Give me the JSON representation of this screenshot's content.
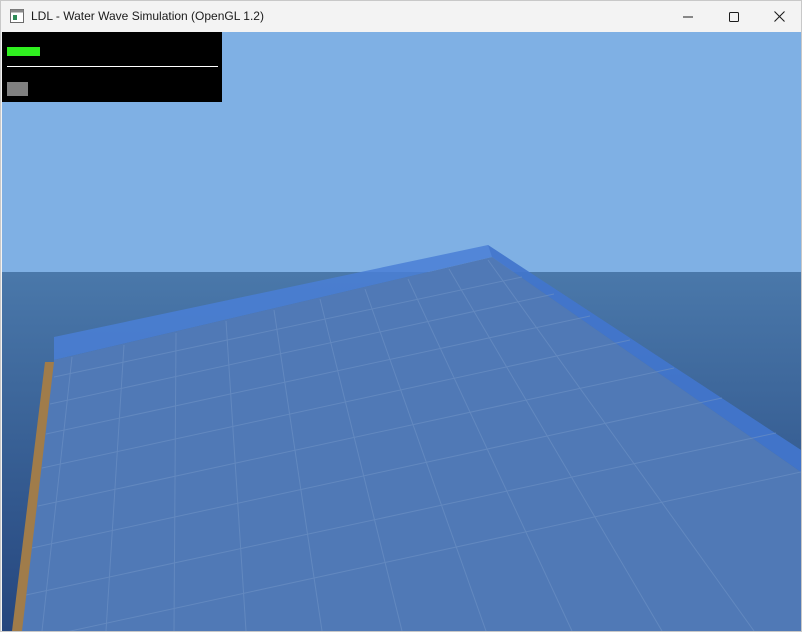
{
  "window": {
    "title": "LDL - Water Wave Simulation (OpenGL 1.2)",
    "app_icon": "window-app-icon",
    "controls": [
      "minimize-icon",
      "maximize-icon",
      "close-icon"
    ]
  },
  "scene": {
    "sky_color": "#7fb0e4",
    "sea_top_color": "#4a78aa",
    "sea_bottom_color": "#2a4f86",
    "water_color": "#4e79b8",
    "pool_wall_color": "#3a6fc8",
    "pool_rim_color": "#a07c4a",
    "tile_line_color": "#6a8fc0"
  },
  "hud": {
    "fps_color": "#30f020",
    "mem_color": "#808080",
    "bar_color": "#000000"
  }
}
